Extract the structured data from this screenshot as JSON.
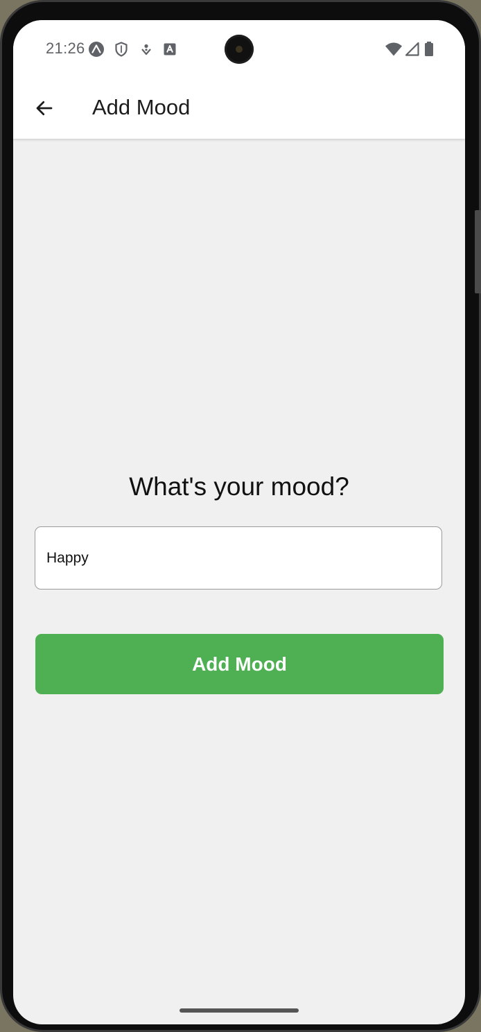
{
  "status_bar": {
    "time": "21:26",
    "left_icons": [
      "expo-icon",
      "shield-icon",
      "location-pin-icon",
      "font-badge-icon"
    ],
    "right_icons": [
      "wifi-icon",
      "cell-signal-icon",
      "battery-icon"
    ]
  },
  "app_bar": {
    "back_icon": "arrow-left-icon",
    "title": "Add Mood"
  },
  "form": {
    "prompt": "What's your mood?",
    "mood_value": "Happy",
    "submit_label": "Add Mood"
  },
  "colors": {
    "accent": "#4faf53",
    "background": "#f0f0f0",
    "app_bar": "#ffffff"
  }
}
